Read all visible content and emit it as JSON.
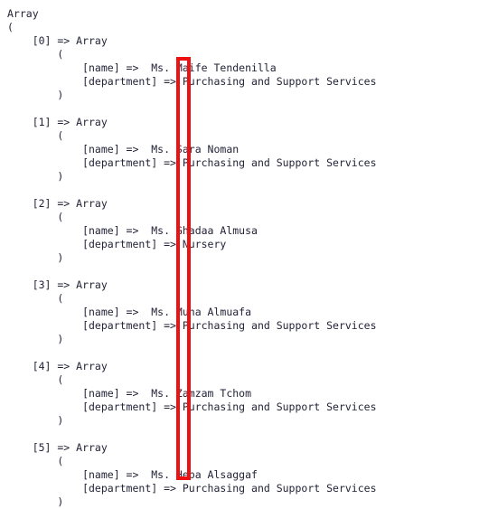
{
  "output": {
    "root_label": "Array",
    "open_paren": "(",
    "close_paren": ")",
    "arrow": "=>",
    "key_name": "[name]",
    "key_department": "[department]",
    "entries": [
      {
        "index": "[0]",
        "type": "Array",
        "name": "Ms. Maife Tendenilla",
        "department": "Purchasing and Support Services"
      },
      {
        "index": "[1]",
        "type": "Array",
        "name": "Ms. Sara Noman",
        "department": "Purchasing and Support Services"
      },
      {
        "index": "[2]",
        "type": "Array",
        "name": "Ms. Ghadaa Almusa",
        "department": "Nursery"
      },
      {
        "index": "[3]",
        "type": "Array",
        "name": "Ms. Muna Almuafa",
        "department": "Purchasing and Support Services"
      },
      {
        "index": "[4]",
        "type": "Array",
        "name": "Ms. Zamzam Tchom",
        "department": "Purchasing and Support Services"
      },
      {
        "index": "[5]",
        "type": "Array",
        "name": "Ms. Heba Alsaggaf",
        "department": "Purchasing and Support Services"
      }
    ]
  },
  "annotation": {
    "shape": "rectangle",
    "color": "#ee1111"
  },
  "style": {
    "text_color": "#232338",
    "background_color": "#ffffff"
  }
}
